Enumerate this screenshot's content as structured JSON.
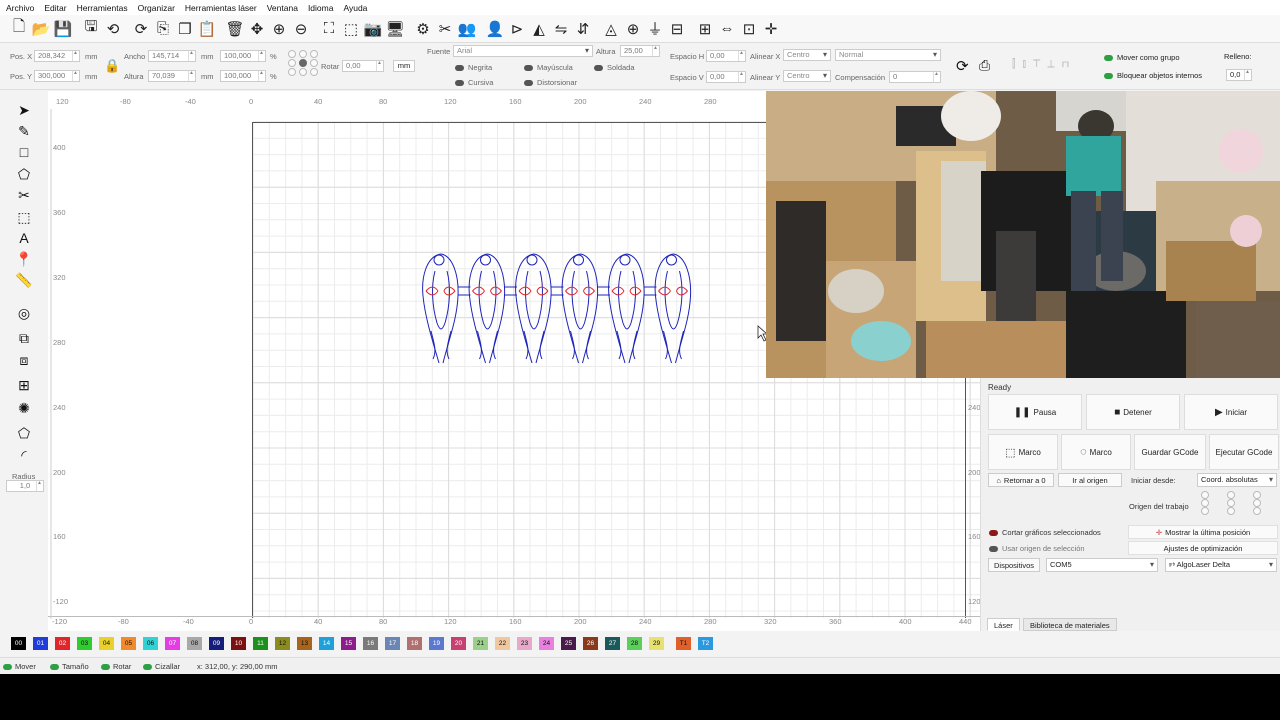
{
  "menu": [
    "Archivo",
    "Editar",
    "Herramientas",
    "Organizar",
    "Herramientas láser",
    "Ventana",
    "Idioma",
    "Ayuda"
  ],
  "toolbar_icons": [
    "new-file-icon",
    "open-folder-icon",
    "save-icon",
    "save-as-icon",
    "undo-icon",
    "redo-icon",
    "import-icon",
    "copy-icon",
    "paste-icon",
    "delete-icon",
    "move-icon",
    "zoom-in-icon",
    "zoom-out-icon",
    "zoom-frame-icon",
    "select-all-icon",
    "camera-icon",
    "monitor-icon",
    "settings-gear-icon",
    "tools-icon",
    "users-icon",
    "user-icon",
    "align-left-icon",
    "align-center-icon",
    "flip-h-icon",
    "flip-v-icon",
    "mirror-icon",
    "crosshair-icon",
    "distribute-icon",
    "dock-icon",
    "center-icon",
    "spread-icon",
    "grid-align-icon",
    "snap-icon"
  ],
  "props": {
    "pos_x_label": "Pos. X",
    "pos_x": "208,342",
    "unit_mm": "mm",
    "pos_y_label": "Pos. Y",
    "pos_y": "300,000",
    "width_label": "Ancho",
    "width": "145,714",
    "height_label": "Altura",
    "height": "70,039",
    "scale_w": "100,000",
    "scale_h": "100,000",
    "pct": "%",
    "rotate_label": "Rotar",
    "rotate": "0,00",
    "unit_btn": "mm",
    "font_label": "Fuente",
    "font": "Arial",
    "font_height_label": "Altura",
    "font_height": "25,00",
    "bold": "Negrita",
    "upper": "Mayúscula",
    "welded": "Soldada",
    "italic": "Cursiva",
    "distort": "Distorsionar",
    "spacing_h_label": "Espacio H",
    "spacing_h": "0,00",
    "spacing_v_label": "Espacio V",
    "spacing_v": "0,00",
    "align_x_label": "Alinear X",
    "align_x": "Centro",
    "align_y_label": "Alinear Y",
    "align_y": "Centro",
    "mode": "Normal",
    "comp_label": "Compensación",
    "comp": "0",
    "move_group": "Mover como grupo",
    "lock_internal": "Bloquear objetos internos",
    "fill_label": "Relleno:",
    "fill": "0,0"
  },
  "left_tools": [
    "select-arrow-icon",
    "pen-icon",
    "rectangle-icon",
    "polygon-icon",
    "scissors-icon",
    "frame-icon",
    "text-icon",
    "position-marker-icon",
    "measure-icon",
    "offset-icon",
    "boolean-icon",
    "weld-icon",
    "array-grid-icon",
    "circular-array-icon",
    "node-edit-icon",
    "corner-icon"
  ],
  "radius": {
    "label": "Radius",
    "value": "1,0"
  },
  "ruler": {
    "top": [
      "120",
      "-80",
      "-40",
      "0",
      "40",
      "80",
      "120",
      "160",
      "200",
      "240",
      "280"
    ],
    "bottom": [
      "-120",
      "-80",
      "-40",
      "0",
      "40",
      "80",
      "120",
      "160",
      "200",
      "240",
      "280",
      "320",
      "360",
      "400",
      "440"
    ],
    "left": [
      "400",
      "360",
      "320",
      "280",
      "240",
      "200",
      "160",
      "-120"
    ],
    "right": [
      "240",
      "200",
      "160",
      "120"
    ],
    "corner_top": "120"
  },
  "laser": {
    "status": "Ready",
    "pause": "Pausa",
    "stop": "Detener",
    "start": "Iniciar",
    "frame1": "Marco",
    "frame2": "Marco",
    "save_gcode": "Guardar GCode",
    "run_gcode": "Ejecutar GCode",
    "home": "Retornar a 0",
    "goto_origin": "Ir al origen",
    "start_from_label": "Iniciar desde:",
    "start_from": "Coord. absolutas",
    "job_origin_label": "Origen del trabajo",
    "cut_selected": "Cortar gráficos seleccionados",
    "use_selection_origin": "Usar origen de selección",
    "show_last_pos": "Mostrar la última posición",
    "optimization": "Ajustes de optimización",
    "devices": "Dispositivos",
    "port": "COM5",
    "device": "AlgoLaser Delta",
    "tab_laser": "Láser",
    "tab_library": "Biblioteca de materiales"
  },
  "palette": [
    {
      "label": "00",
      "color": "#000000",
      "fg": "#ffffff"
    },
    {
      "label": "01",
      "color": "#1f3bd8",
      "fg": "#ffffff"
    },
    {
      "label": "02",
      "color": "#e0262b",
      "fg": "#ffffff"
    },
    {
      "label": "03",
      "color": "#2ecc2e",
      "fg": "#111111"
    },
    {
      "label": "04",
      "color": "#e8d12a",
      "fg": "#111111"
    },
    {
      "label": "05",
      "color": "#f08a2c",
      "fg": "#111111"
    },
    {
      "label": "06",
      "color": "#2fd3d3",
      "fg": "#111111"
    },
    {
      "label": "07",
      "color": "#e43de4",
      "fg": "#ffffff"
    },
    {
      "label": "08",
      "color": "#a8a8a8",
      "fg": "#111111"
    },
    {
      "label": "09",
      "color": "#141e7a",
      "fg": "#ffffff"
    },
    {
      "label": "10",
      "color": "#7a1010",
      "fg": "#ffffff"
    },
    {
      "label": "11",
      "color": "#1c8f1c",
      "fg": "#ffffff"
    },
    {
      "label": "12",
      "color": "#8c8c1e",
      "fg": "#111111"
    },
    {
      "label": "13",
      "color": "#a8641c",
      "fg": "#111111"
    },
    {
      "label": "14",
      "color": "#1ea0d8",
      "fg": "#ffffff"
    },
    {
      "label": "15",
      "color": "#8c1e8c",
      "fg": "#ffffff"
    },
    {
      "label": "16",
      "color": "#7a7a7a",
      "fg": "#ffffff"
    },
    {
      "label": "17",
      "color": "#6a86b4",
      "fg": "#ffffff"
    },
    {
      "label": "18",
      "color": "#b07070",
      "fg": "#ffffff"
    },
    {
      "label": "19",
      "color": "#5a78d0",
      "fg": "#ffffff"
    },
    {
      "label": "20",
      "color": "#c84070",
      "fg": "#ffffff"
    },
    {
      "label": "21",
      "color": "#9ad08a",
      "fg": "#111111"
    },
    {
      "label": "22",
      "color": "#f0c8a0",
      "fg": "#111111"
    },
    {
      "label": "23",
      "color": "#e8a8c8",
      "fg": "#111111"
    },
    {
      "label": "24",
      "color": "#e880e0",
      "fg": "#111111"
    },
    {
      "label": "25",
      "color": "#4a1a4a",
      "fg": "#ffffff"
    },
    {
      "label": "26",
      "color": "#8a3a1a",
      "fg": "#ffffff"
    },
    {
      "label": "27",
      "color": "#1a5a5a",
      "fg": "#ffffff"
    },
    {
      "label": "28",
      "color": "#5ad05a",
      "fg": "#111111"
    },
    {
      "label": "29",
      "color": "#e8e070",
      "fg": "#111111"
    },
    {
      "label": "T1",
      "color": "#e0602a",
      "fg": "#111111"
    },
    {
      "label": "T2",
      "color": "#2a9ae0",
      "fg": "#ffffff"
    }
  ],
  "status": {
    "move": "Mover",
    "size": "Tamaño",
    "rotate": "Rotar",
    "shear": "Cizallar",
    "coords": "x: 312,00, y: 290,00 mm"
  }
}
